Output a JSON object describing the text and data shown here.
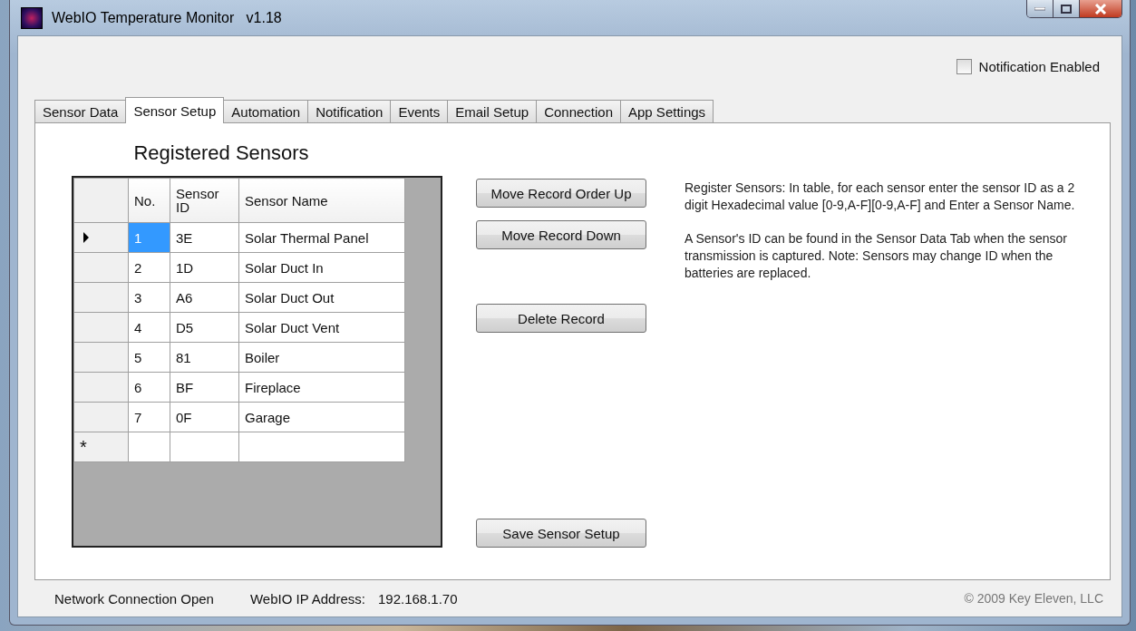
{
  "window": {
    "title": "WebIO Temperature Monitor   v1.18"
  },
  "notification": {
    "label": "Notification Enabled",
    "checked": false
  },
  "tabs": [
    {
      "label": "Sensor Data",
      "selected": false
    },
    {
      "label": "Sensor Setup",
      "selected": true
    },
    {
      "label": "Automation",
      "selected": false
    },
    {
      "label": "Notification",
      "selected": false
    },
    {
      "label": "Events",
      "selected": false
    },
    {
      "label": "Email Setup",
      "selected": false
    },
    {
      "label": "Connection",
      "selected": false
    },
    {
      "label": "App Settings",
      "selected": false
    }
  ],
  "heading": "Registered Sensors",
  "table": {
    "columns": [
      "No.",
      "Sensor ID",
      "Sensor Name"
    ],
    "rows": [
      {
        "cells": [
          "1",
          "3E",
          "Solar Thermal Panel"
        ],
        "selected": true
      },
      {
        "cells": [
          "2",
          "1D",
          "Solar Duct In"
        ],
        "selected": false
      },
      {
        "cells": [
          "3",
          "A6",
          "Solar Duct Out"
        ],
        "selected": false
      },
      {
        "cells": [
          "4",
          "D5",
          "Solar Duct Vent"
        ],
        "selected": false
      },
      {
        "cells": [
          "5",
          "81",
          "Boiler"
        ],
        "selected": false
      },
      {
        "cells": [
          "6",
          "BF",
          "Fireplace"
        ],
        "selected": false
      },
      {
        "cells": [
          "7",
          "0F",
          "Garage"
        ],
        "selected": false
      }
    ],
    "new_row_marker": "*"
  },
  "buttons": [
    {
      "label": "Move Record Order Up",
      "kind": "top"
    },
    {
      "label": "Move Record Down",
      "kind": "top"
    },
    {
      "label": "Delete Record",
      "kind": "middle"
    },
    {
      "label": "Save Sensor Setup",
      "kind": "bottom"
    }
  ],
  "description": [
    "Register Sensors:  In table, for each sensor enter the sensor ID as a 2 digit Hexadecimal value [0-9,A-F][0-9,A-F] and Enter a Sensor Name.",
    "A Sensor's ID can be found in the Sensor Data Tab when the sensor transmission is captured.  Note: Sensors may change ID when the batteries are replaced."
  ],
  "status_bar": {
    "connection": "Network Connection Open",
    "ip_label": "WebIO IP Address:",
    "ip": "192.168.1.70",
    "copyright": "© 2009 Key Eleven, LLC"
  }
}
